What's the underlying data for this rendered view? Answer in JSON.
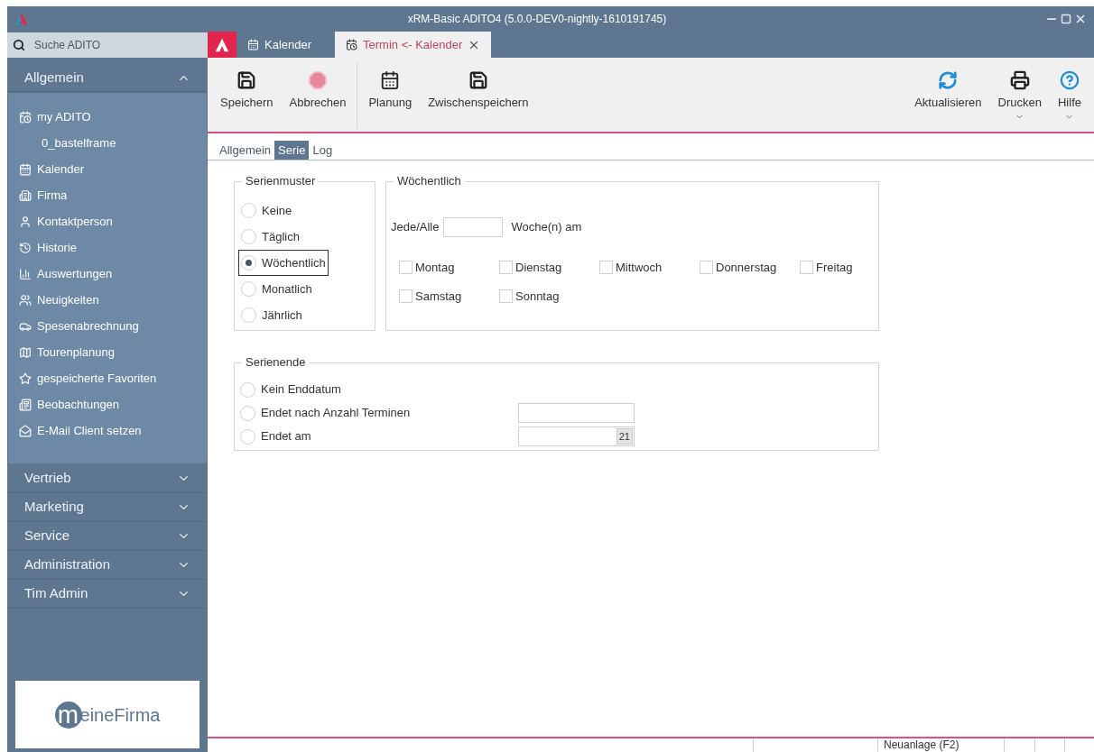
{
  "window": {
    "title": "xRM-Basic ADITO4 (5.0.0-DEV0-nightly-1610191745)"
  },
  "search": {
    "placeholder": "Suche ADITO"
  },
  "sidebar": {
    "sections": [
      {
        "label": "Allgemein",
        "expanded": true,
        "items": [
          {
            "label": "my ADITO",
            "children": [
              {
                "label": "0_bastelframe"
              }
            ]
          },
          {
            "label": "Kalender"
          },
          {
            "label": "Firma"
          },
          {
            "label": "Kontaktperson"
          },
          {
            "label": "Historie"
          },
          {
            "label": "Auswertungen"
          },
          {
            "label": "Neuigkeiten"
          },
          {
            "label": "Spesenabrechnung"
          },
          {
            "label": "Tourenplanung"
          },
          {
            "label": "gespeicherte Favoriten"
          },
          {
            "label": "Beobachtungen"
          },
          {
            "label": "E-Mail Client setzen"
          }
        ]
      },
      {
        "label": "Vertrieb",
        "expanded": false
      },
      {
        "label": "Marketing",
        "expanded": false
      },
      {
        "label": "Service",
        "expanded": false
      },
      {
        "label": "Administration",
        "expanded": false
      },
      {
        "label": "Tim Admin",
        "expanded": false
      }
    ]
  },
  "logo": {
    "initial": "m",
    "rest": "eineFirma"
  },
  "tabs": [
    {
      "label": "Kalender",
      "selected": false,
      "closable": false
    },
    {
      "label": "Termin <- Kalender",
      "selected": true,
      "closable": true
    }
  ],
  "toolbar": {
    "left": [
      {
        "label": "Speichern",
        "dropdown": false
      },
      {
        "label": "Abbrechen",
        "dropdown": false
      },
      {
        "label": "Planung",
        "dropdown": false
      },
      {
        "label": "Zwischenspeichern",
        "dropdown": false
      }
    ],
    "right": [
      {
        "label": "Aktualisieren",
        "dropdown": false
      },
      {
        "label": "Drucken",
        "dropdown": true
      },
      {
        "label": "Hilfe",
        "dropdown": true
      }
    ]
  },
  "subtabs": [
    {
      "label": "Allgemein",
      "selected": false
    },
    {
      "label": "Serie",
      "selected": true
    },
    {
      "label": "Log",
      "selected": false
    }
  ],
  "serienmuster": {
    "title": "Serienmuster",
    "options": [
      {
        "label": "Keine",
        "selected": false,
        "focused": false
      },
      {
        "label": "Täglich",
        "selected": false,
        "focused": false
      },
      {
        "label": "Wöchentlich",
        "selected": true,
        "focused": true
      },
      {
        "label": "Monatlich",
        "selected": false,
        "focused": false
      },
      {
        "label": "Jährlich",
        "selected": false,
        "focused": false
      }
    ]
  },
  "weekly": {
    "title": "Wöchentlich",
    "every_label": "Jede/Alle",
    "unit_label": "Woche(n) am",
    "days": [
      {
        "label": "Montag",
        "checked": false
      },
      {
        "label": "Dienstag",
        "checked": false
      },
      {
        "label": "Mittwoch",
        "checked": false
      },
      {
        "label": "Donnerstag",
        "checked": false
      },
      {
        "label": "Freitag",
        "checked": false
      },
      {
        "label": "Samstag",
        "checked": false
      },
      {
        "label": "Sonntag",
        "checked": false
      }
    ]
  },
  "serienende": {
    "title": "Serienende",
    "options": [
      {
        "label": "Kein Enddatum",
        "selected": false,
        "kind": "plain"
      },
      {
        "label": "Endet nach Anzahl Terminen",
        "selected": false,
        "kind": "count"
      },
      {
        "label": "Endet am",
        "selected": false,
        "kind": "date"
      }
    ],
    "date_button": "21"
  },
  "status_bar": {
    "cells": [
      {
        "text": "Neuanlage (F2)"
      }
    ]
  }
}
